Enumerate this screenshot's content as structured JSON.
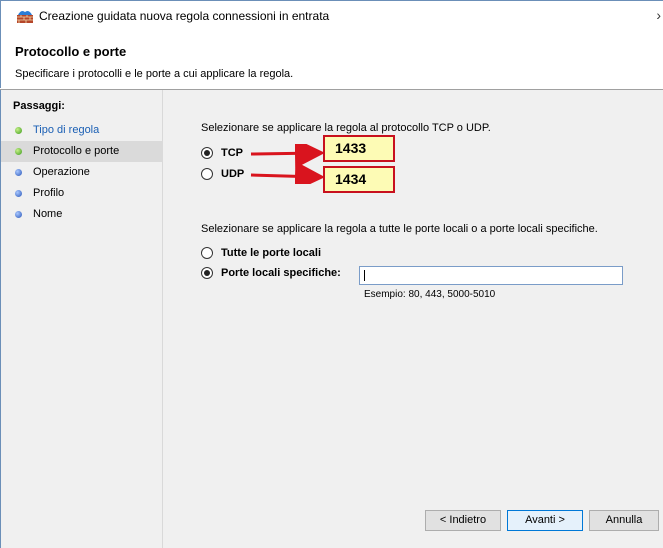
{
  "window": {
    "title": "Creazione guidata nuova regola connessioni in entrata",
    "close_glyph": "›"
  },
  "header": {
    "title": "Protocollo e porte",
    "subtitle": "Specificare i protocolli e le porte a cui applicare la regola."
  },
  "sidebar": {
    "title": "Passaggi:",
    "items": [
      {
        "label": "Tipo di regola",
        "state": "link",
        "dot_color": "#3a9a1a"
      },
      {
        "label": "Protocollo e porte",
        "state": "current",
        "dot_color": "#3a9a1a"
      },
      {
        "label": "Operazione",
        "state": "pending",
        "dot_color": "#2855b8"
      },
      {
        "label": "Profilo",
        "state": "pending",
        "dot_color": "#2855b8"
      },
      {
        "label": "Nome",
        "state": "pending",
        "dot_color": "#2855b8"
      }
    ]
  },
  "protocol": {
    "question": "Selezionare se applicare la regola al protocollo TCP o UDP.",
    "options": [
      {
        "label": "TCP",
        "checked": true,
        "annotation": "1433"
      },
      {
        "label": "UDP",
        "checked": false,
        "annotation": "1434"
      }
    ]
  },
  "ports": {
    "question": "Selezionare se applicare la regola a tutte le porte locali o a porte locali specifiche.",
    "options": [
      {
        "label": "Tutte le porte locali",
        "checked": false
      },
      {
        "label": "Porte locali specifiche:",
        "checked": true
      }
    ],
    "input_value": "",
    "example": "Esempio: 80, 443, 5000-5010"
  },
  "buttons": {
    "back": "< Indietro",
    "next": "Avanti >",
    "cancel": "Annulla"
  },
  "colors": {
    "annotation_border": "#c8101e",
    "annotation_fill": "#fdfbb5",
    "arrow": "#d9141e",
    "link": "#1a5fb4"
  }
}
